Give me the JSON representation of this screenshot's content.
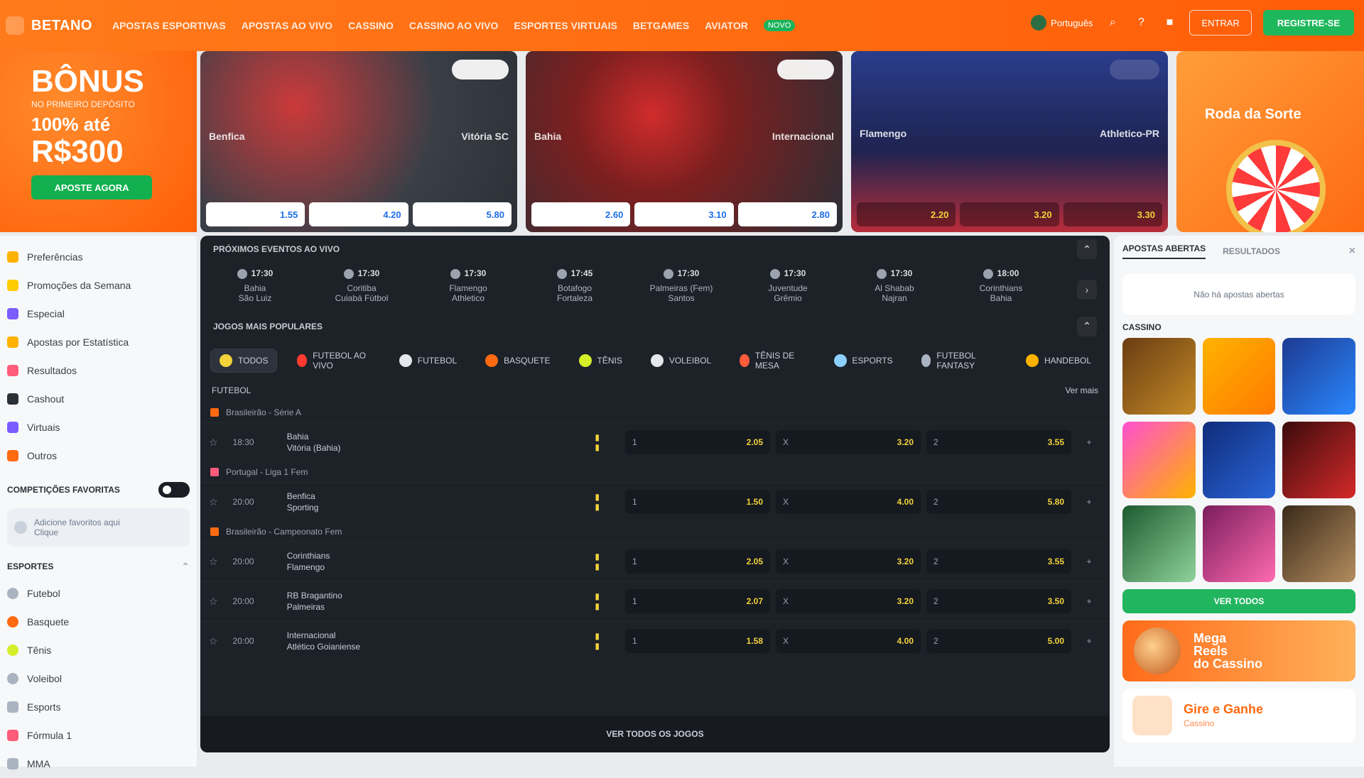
{
  "header": {
    "brand": "BETANO",
    "nav": [
      "APOSTAS ESPORTIVAS",
      "APOSTAS AO VIVO",
      "CASSINO",
      "CASSINO AO VIVO",
      "ESPORTES VIRTUAIS",
      "BETGAMES",
      "AVIATOR",
      "NOVO"
    ],
    "language": "Português",
    "login": "ENTRAR",
    "signup": "REGISTRE-SE"
  },
  "promo_left": {
    "title": "BÔNUS",
    "subtitle": "NO PRIMEIRO DEPÓSITO",
    "line": "100% até",
    "amount": "R$300",
    "cta": "APOSTE AGORA"
  },
  "hero": [
    {
      "left_label": "Benfica",
      "right_label": "Vitória SC",
      "odds": [
        "1.55",
        "4.20",
        "5.80"
      ]
    },
    {
      "left_label": "Bahia",
      "right_label": "Internacional",
      "odds": [
        "2.60",
        "3.10",
        "2.80"
      ]
    },
    {
      "left_label": "Flamengo",
      "right_label": "Athletico-PR",
      "odds": [
        "2.20",
        "3.20",
        "3.30"
      ]
    }
  ],
  "promo_right": {
    "title": "Roda da Sorte"
  },
  "sidebar": {
    "top_items": [
      {
        "label": "Preferências",
        "icon": "star-icon",
        "color": "#ffb300"
      },
      {
        "label": "Promoções da Semana",
        "icon": "gift-icon",
        "color": "#ffcc00"
      },
      {
        "label": "Especial",
        "icon": "bolt-icon",
        "color": "#7a5cff"
      },
      {
        "label": "Apostas por Estatística",
        "icon": "chart-icon",
        "color": "#ffb300"
      },
      {
        "label": "Resultados",
        "icon": "flag-icon",
        "color": "#ff5c7a"
      },
      {
        "label": "Cashout",
        "icon": "coin-icon",
        "color": "#2b2f36"
      },
      {
        "label": "Virtuais",
        "icon": "virtual-icon",
        "color": "#7a5cff"
      },
      {
        "label": "Outros",
        "icon": "more-icon",
        "color": "#ff6a10"
      }
    ],
    "favorites_title": "COMPETIÇÕES FAVORITAS",
    "favorites_hint": "Adicione favoritos aqui",
    "favorites_hint2": "Clique",
    "sports_title": "ESPORTES",
    "sports": [
      {
        "label": "Futebol",
        "icon": "soccer-icon",
        "color": "#aab3c0"
      },
      {
        "label": "Basquete",
        "icon": "basketball-icon",
        "color": "#ff6a10"
      },
      {
        "label": "Tênis",
        "icon": "tennis-icon",
        "color": "#d4ef29"
      },
      {
        "label": "Voleibol",
        "icon": "volleyball-icon",
        "color": "#aab3c0"
      },
      {
        "label": "Esports",
        "icon": "esports-icon",
        "color": "#aab3c0"
      },
      {
        "label": "Fórmula 1",
        "icon": "f1-icon",
        "color": "#ff5c7a"
      },
      {
        "label": "MMA",
        "icon": "mma-icon",
        "color": "#aab3c0"
      }
    ]
  },
  "main": {
    "starting_title": "PRÓXIMOS EVENTOS AO VIVO",
    "starting": [
      {
        "time": "17:30",
        "name1": "Bahia",
        "name2": "São Luiz"
      },
      {
        "time": "17:30",
        "name1": "Coritiba",
        "name2": "Cuiabá Fútbol"
      },
      {
        "time": "17:30",
        "name1": "Flamengo",
        "name2": "Athletico"
      },
      {
        "time": "17:45",
        "name1": "Botafogo",
        "name2": "Fortaleza"
      },
      {
        "time": "17:30",
        "name1": "Palmeiras (Fem)",
        "name2": "Santos"
      },
      {
        "time": "17:30",
        "name1": "Juventude",
        "name2": "Grêmio"
      },
      {
        "time": "17:30",
        "name1": "Al Shabab",
        "name2": "Najran"
      },
      {
        "time": "18:00",
        "name1": "Corinthians",
        "name2": "Bahia"
      }
    ],
    "popular_title": "JOGOS MAIS POPULARES",
    "chips": [
      {
        "label": "TODOS",
        "icon": "all-icon",
        "color": "#f2d33a",
        "active": true
      },
      {
        "label": "FUTEBOL AO VIVO",
        "icon": "fire-icon",
        "color": "#ff3b2f",
        "active": false
      },
      {
        "label": "FUTEBOL",
        "icon": "soccer-icon",
        "color": "#e4e7ec",
        "active": false
      },
      {
        "label": "BASQUETE",
        "icon": "basketball-icon",
        "color": "#ff6a10",
        "active": false
      },
      {
        "label": "TÊNIS",
        "icon": "tennis-icon",
        "color": "#d4ef29",
        "active": false
      },
      {
        "label": "VOLEIBOL",
        "icon": "volleyball-icon",
        "color": "#e4e7ec",
        "active": false
      },
      {
        "label": "TÊNIS DE MESA",
        "icon": "table-tennis-icon",
        "color": "#ff5c3b",
        "active": false
      },
      {
        "label": "ESPORTS",
        "icon": "esports-icon",
        "color": "#8bd0ff",
        "active": false
      },
      {
        "label": "FUTEBOL FANTASY",
        "icon": "fantasy-icon",
        "color": "#aab3c0",
        "active": false
      },
      {
        "label": "HANDEBOL",
        "icon": "handball-icon",
        "color": "#ffb300",
        "active": false
      }
    ],
    "league_sub_title": "FUTEBOL",
    "league_sub_right": "Ver mais",
    "groups": [
      {
        "league": "Brasileirão - Série A",
        "flag_color": "#ff6a10",
        "matches": [
          {
            "time": "18:30",
            "team1": "Bahia",
            "team2": "Vitória (Bahia)",
            "o1": "2.05",
            "o2": "3.20",
            "o3": "3.55"
          }
        ]
      },
      {
        "league": "Portugal - Liga 1 Fem",
        "flag_color": "#ff5c7a",
        "matches": [
          {
            "time": "20:00",
            "team1": "Benfica",
            "team2": "Sporting",
            "o1": "1.50",
            "o2": "4.00",
            "o3": "5.80"
          }
        ]
      },
      {
        "league": "Brasileirão - Campeonato Fem",
        "flag_color": "#ff6a10",
        "matches": [
          {
            "time": "20:00",
            "team1": "Corinthians",
            "team2": "Flamengo",
            "o1": "2.05",
            "o2": "3.20",
            "o3": "3.55"
          },
          {
            "time": "20:00",
            "team1": "RB Bragantino",
            "team2": "Palmeiras",
            "o1": "2.07",
            "o2": "3.20",
            "o3": "3.50"
          },
          {
            "time": "20:00",
            "team1": "Internacional",
            "team2": "Atlético Goianiense",
            "o1": "1.58",
            "o2": "4.00",
            "o3": "5.00"
          }
        ]
      }
    ],
    "see_all": "VER TODOS OS JOGOS"
  },
  "rightpanel": {
    "tab1": "APOSTAS ABERTAS",
    "tab2": "RESULTADOS",
    "empty": "Não há apostas abertas",
    "casino_title": "CASSINO",
    "games": [
      "#8a5a1a",
      "#ffb300",
      "#2d6bff",
      "#ff4fd1",
      "#1a56c8",
      "#c41b1b",
      "#2f8b46",
      "#b23b7f",
      "#6b4b2a"
    ],
    "more": "VER TODOS",
    "banner1_line1": "Mega",
    "banner1_line2": "Reels",
    "banner1_line3": "do Cassino",
    "banner2_title": "Gire e Ganhe",
    "banner2_sub": "Cassino"
  }
}
